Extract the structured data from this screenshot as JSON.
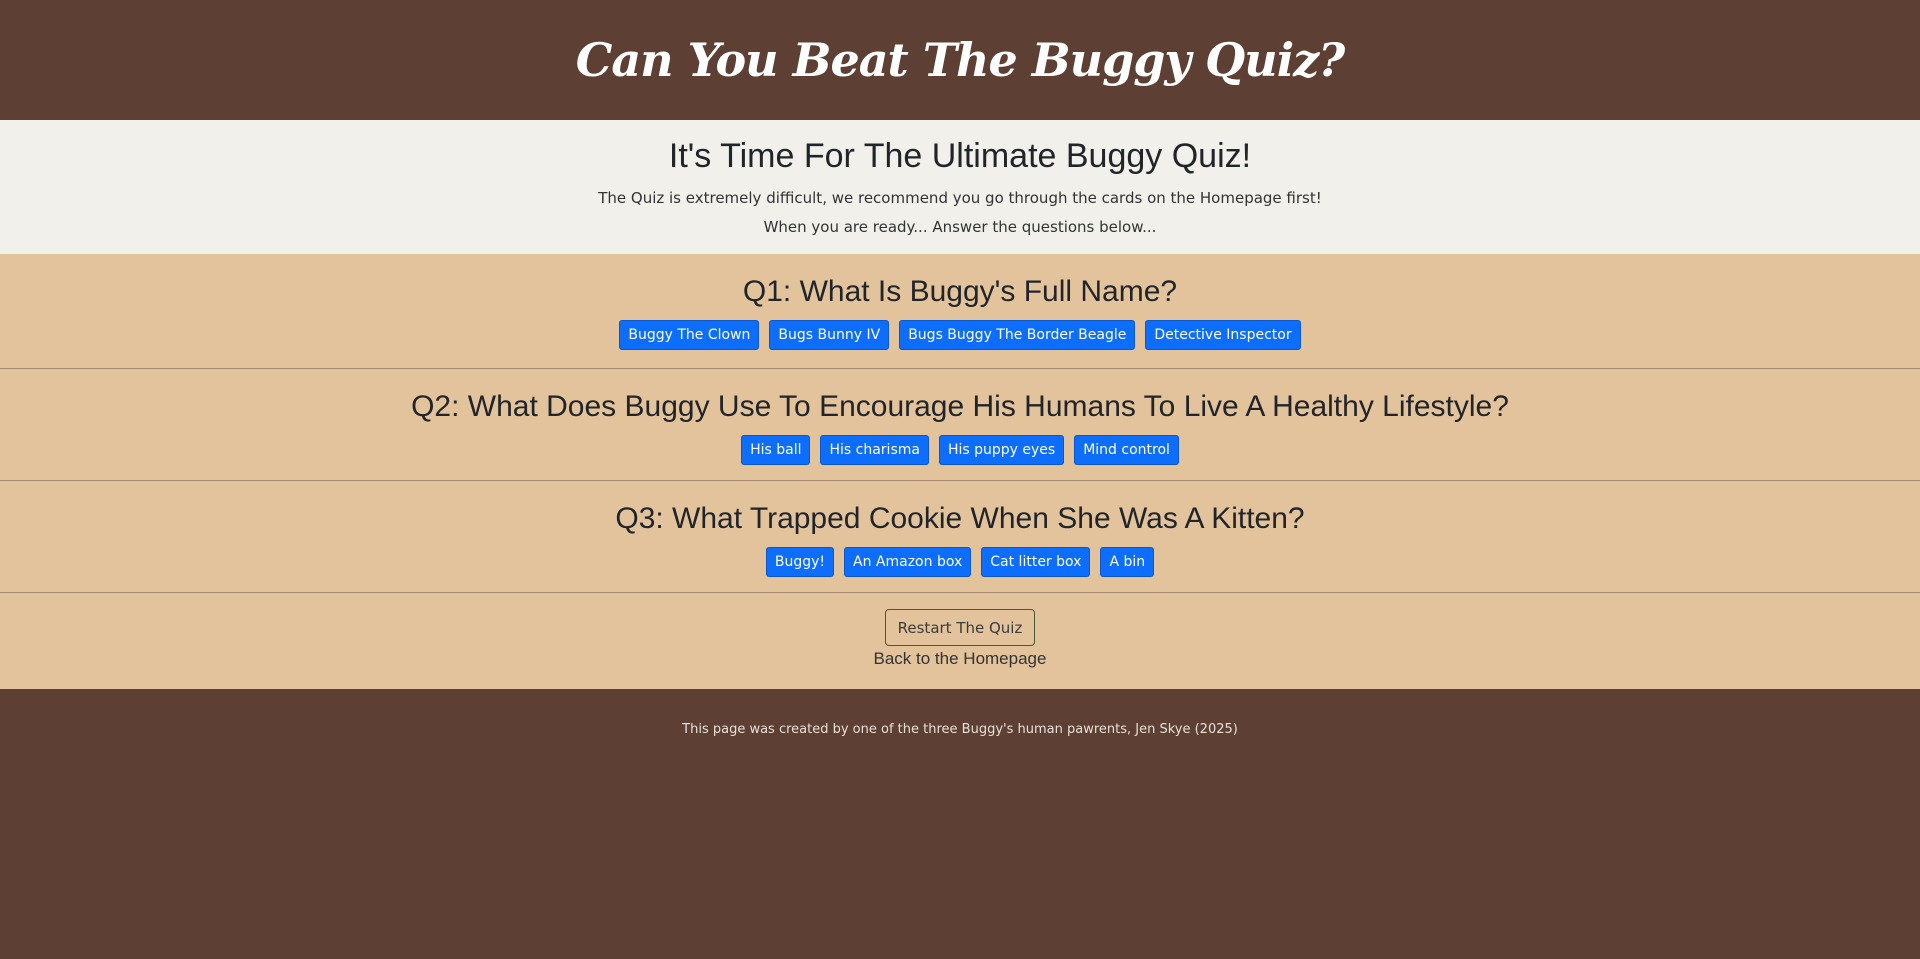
{
  "header": {
    "title": "Can You Beat The Buggy Quiz?"
  },
  "intro": {
    "heading": "It's Time For The Ultimate Buggy Quiz!",
    "line1": "The Quiz is extremely difficult, we recommend you go through the cards on the Homepage first!",
    "line2": "When you are ready... Answer the questions below..."
  },
  "questions": [
    {
      "title": "Q1: What Is Buggy's Full Name?",
      "answers": [
        "Buggy The Clown",
        "Bugs Bunny IV",
        "Bugs Buggy The Border Beagle",
        "Detective Inspector"
      ]
    },
    {
      "title": "Q2: What Does Buggy Use To Encourage His Humans To Live A Healthy Lifestyle?",
      "answers": [
        "His ball",
        "His charisma",
        "His puppy eyes",
        "Mind control"
      ]
    },
    {
      "title": "Q3: What Trapped Cookie When She Was A Kitten?",
      "answers": [
        "Buggy!",
        "An Amazon box",
        "Cat litter box",
        "A bin"
      ]
    }
  ],
  "controls": {
    "restart_label": "Restart The Quiz",
    "home_link": "Back to the Homepage"
  },
  "footer": {
    "credit": "This page was created by one of the three Buggy's human pawrents, Jen Skye (2025)"
  },
  "colors": {
    "header_bg": "#5d4033",
    "intro_bg": "#f1f0eb",
    "quiz_bg": "#e3c39c",
    "answer_button": "#0d6efd"
  }
}
